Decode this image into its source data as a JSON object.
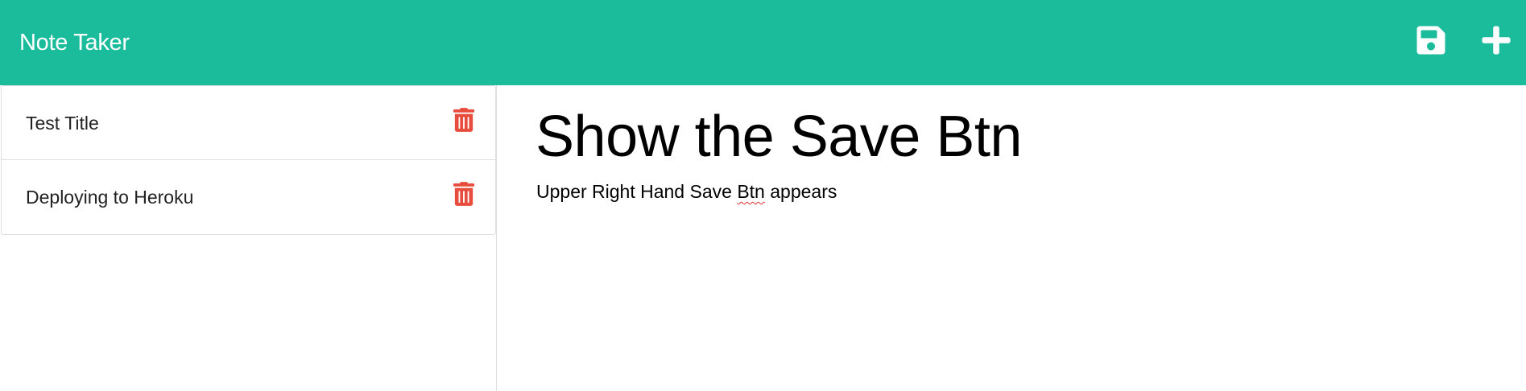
{
  "app": {
    "title": "Note Taker"
  },
  "toolbar": {
    "save_icon": "save-icon",
    "new_icon": "plus-icon"
  },
  "colors": {
    "navbar": "#1abc9c",
    "delete": "#e74c3c",
    "icon": "#ffffff"
  },
  "notes": [
    {
      "title": "Test Title",
      "delete_icon": "trash-icon"
    },
    {
      "title": "Deploying to Heroku",
      "delete_icon": "trash-icon"
    }
  ],
  "active_note": {
    "title": "Show the Save Btn",
    "body_before": "Upper Right Hand Save ",
    "body_misspelled": "Btn",
    "body_after": " appears"
  }
}
